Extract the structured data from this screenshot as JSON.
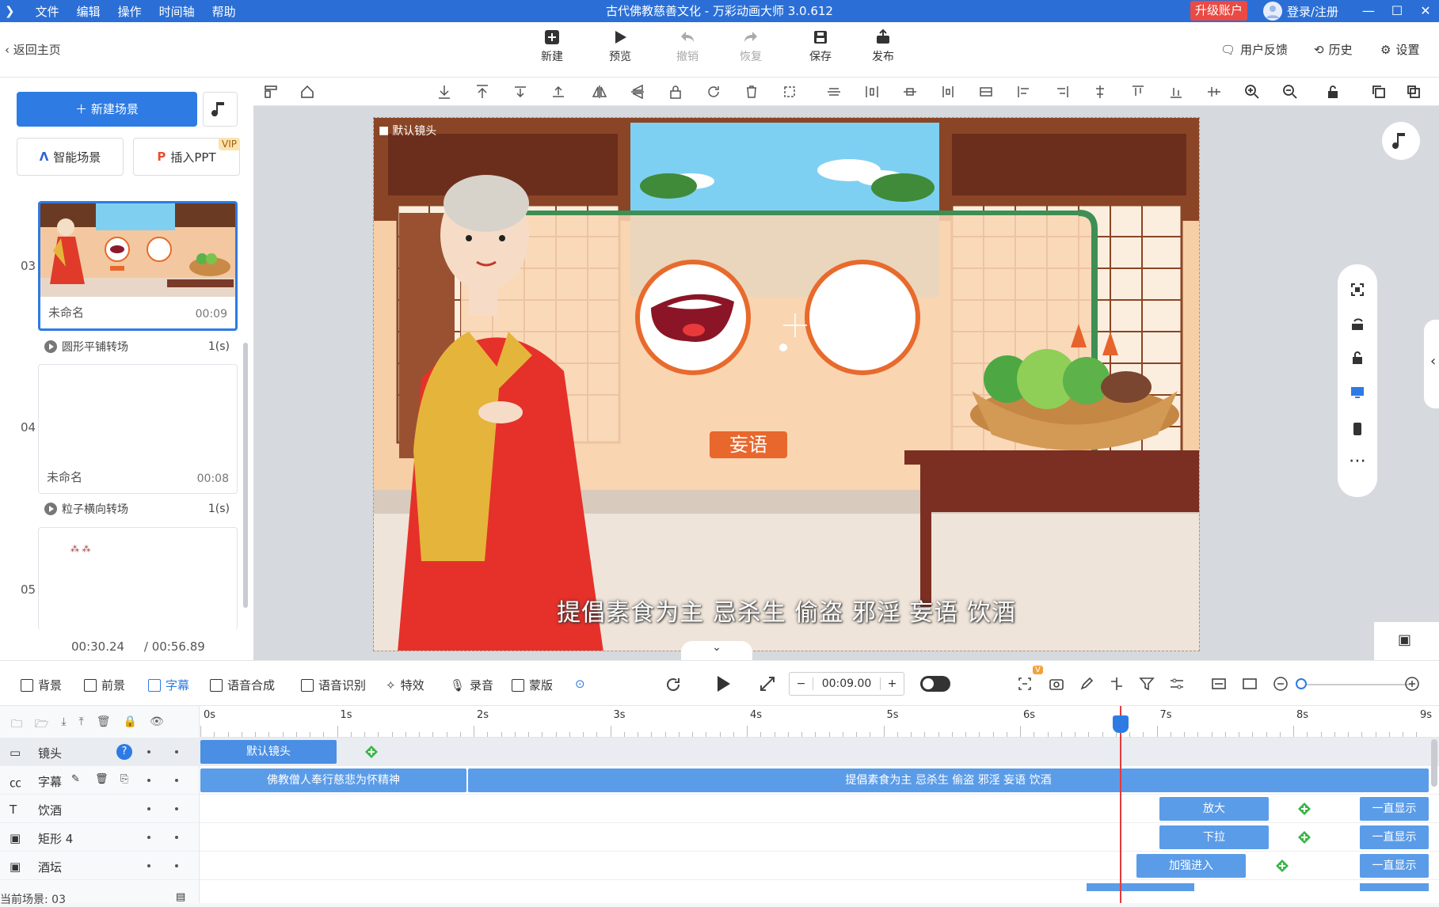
{
  "titlebar": {
    "menu": [
      "文件",
      "编辑",
      "操作",
      "时间轴",
      "帮助"
    ],
    "title": "古代佛教慈善文化 - 万彩动画大师 3.0.612",
    "upgrade": "升级账户",
    "login": "登录/注册"
  },
  "toolbar": {
    "back": "返回主页",
    "new": "新建",
    "preview": "预览",
    "undo": "撤销",
    "redo": "恢复",
    "save": "保存",
    "publish": "发布",
    "feedback": "用户反馈",
    "history": "历史",
    "settings": "设置"
  },
  "left": {
    "new_scene": "新建场景",
    "smart_scene": "智能场景",
    "insert_ppt": "插入PPT",
    "vip": "VIP",
    "scenes": [
      {
        "num": "03",
        "name": "未命名",
        "dur": "00:09"
      },
      {
        "num": "04",
        "name": "未命名",
        "dur": "00:08"
      },
      {
        "num": "05",
        "name": "",
        "dur": ""
      }
    ],
    "transitions": [
      {
        "name": "圆形平铺转场",
        "dur": "1(s)"
      },
      {
        "name": "粒子横向转场",
        "dur": "1(s)"
      }
    ],
    "time_current": "00:30.24",
    "time_total": "/ 00:56.89"
  },
  "canvas": {
    "camera_label": "默认镜头",
    "circle_label": "妄语",
    "subtitle": "提倡素食为主 忌杀生 偷盗 邪淫 妄语 饮酒"
  },
  "timeline_tools": {
    "background": "背景",
    "foreground": "前景",
    "caption": "字幕",
    "tts": "语音合成",
    "asr": "语音识别",
    "effects": "特效",
    "record": "录音",
    "mask": "蒙版",
    "time_value": "00:09.00",
    "minus": "−",
    "plus": "+",
    "v_badge": "V"
  },
  "timeline": {
    "ticks": [
      "0s",
      "1s",
      "2s",
      "3s",
      "4s",
      "5s",
      "6s",
      "7s",
      "8s",
      "9s"
    ],
    "rows": [
      {
        "label": "镜头"
      },
      {
        "label": "字幕"
      },
      {
        "label": "饮酒"
      },
      {
        "label": "矩形 4"
      },
      {
        "label": "酒坛"
      }
    ],
    "clips": {
      "camera": "默认镜头",
      "caption1": "佛教僧人奉行慈悲为怀精神",
      "caption2": "提倡素食为主 忌杀生 偷盗 邪淫 妄语 饮酒",
      "r1_anim": "放大",
      "r1_end": "一直显示",
      "r2_anim": "下拉",
      "r2_end": "一直显示",
      "r3_anim": "加强进入",
      "r3_end": "一直显示"
    },
    "current_scene": "当前场景: 03"
  },
  "colors": {
    "brand": "#2b6fd6",
    "accent": "#2e7be4",
    "upgrade": "#ea4a43",
    "clip": "#5b9ce8",
    "playhead": "#e23b3b"
  }
}
